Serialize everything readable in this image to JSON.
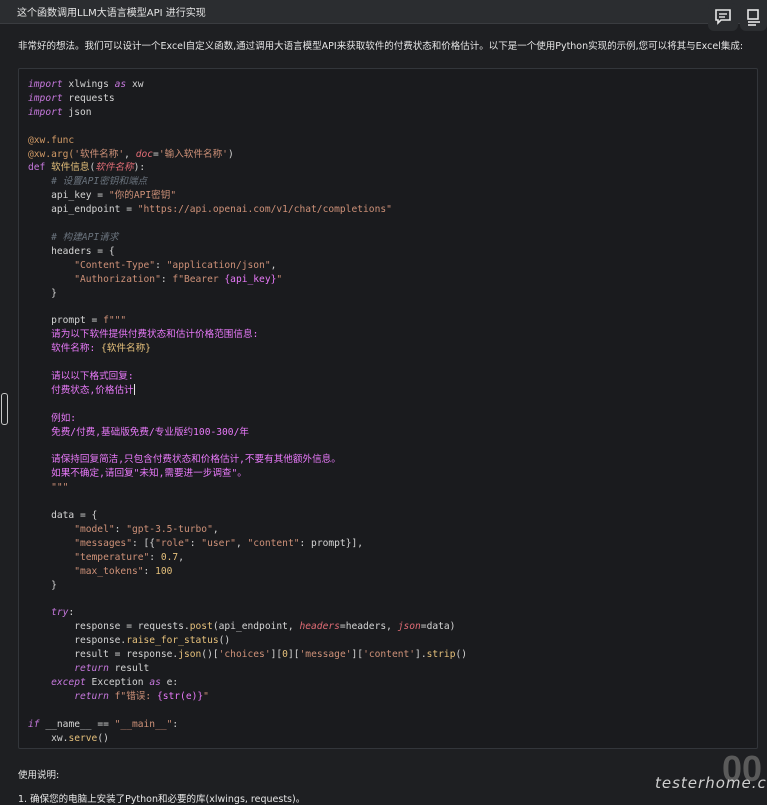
{
  "question": "这个函数调用LLM大语言模型API 进行实现",
  "intro": "非常好的想法。我们可以设计一个Excel自定义函数,通过调用大语言模型API来获取软件的付费状态和价格估计。以下是一个使用Python实现的示例,您可以将其与Excel集成:",
  "code": {
    "l1_import": "import",
    "l1_mod": " xlwings ",
    "l1_as": "as",
    "l1_alias": " xw",
    "l2_import": "import",
    "l2_mod": " requests",
    "l3_import": "import",
    "l3_mod": " json",
    "l5_dec": "@xw.func",
    "l6_dec": "@xw.arg(",
    "l6_str": "'软件名称'",
    "l6_mid": ", ",
    "l6_kw": "doc",
    "l6_eq": "=",
    "l6_str2": "'输入软件名称'",
    "l6_end": ")",
    "l7_def": "def",
    "l7_sp": " ",
    "l7_fn": "软件信息",
    "l7_p1": "(",
    "l7_param": "软件名称",
    "l7_p2": "):",
    "l8_cmt": "    # 设置API密钥和端点",
    "l9_var": "    api_key = ",
    "l9_str": "\"你的API密钥\"",
    "l10_var": "    api_endpoint = ",
    "l10_str": "\"https://api.openai.com/v1/chat/completions\"",
    "l12_cmt": "    # 构建API请求",
    "l13": "    headers = {",
    "l14_k": "        \"Content-Type\"",
    "l14_c": ": ",
    "l14_v": "\"application/json\"",
    "l14_e": ",",
    "l15_k": "        \"Authorization\"",
    "l15_c": ": ",
    "l15_v": "f\"Bearer ",
    "l15_b": "{api_key}",
    "l15_q": "\"",
    "l16": "    }",
    "l18_var": "    prompt = ",
    "l18_str": "f\"\"\"",
    "l19": "    请为以下软件提供付费状态和估计价格范围信息:",
    "l20_a": "    软件名称: ",
    "l20_b": "{软件名称}",
    "l22": "    请以以下格式回复:",
    "l23": "    付费状态,价格估计",
    "l25": "    例如:",
    "l26": "    免费/付费,基础版免费/专业版约100-300/年",
    "l28": "    请保持回复简洁,只包含付费状态和价格估计,不要有其他额外信息。",
    "l29": "    如果不确定,请回复\"未知,需要进一步调查\"。",
    "l30": "    \"\"\"",
    "l32": "    data = {",
    "l33_k": "        \"model\"",
    "l33_c": ": ",
    "l33_v": "\"gpt-3.5-turbo\"",
    "l33_e": ",",
    "l34_k": "        \"messages\"",
    "l34_c": ": [{",
    "l34_k2": "\"role\"",
    "l34_c2": ": ",
    "l34_v2": "\"user\"",
    "l34_c3": ", ",
    "l34_k3": "\"content\"",
    "l34_c4": ": prompt}],",
    "l35_k": "        \"temperature\"",
    "l35_c": ": ",
    "l35_v": "0.7",
    "l35_e": ",",
    "l36_k": "        \"max_tokens\"",
    "l36_c": ": ",
    "l36_v": "100",
    "l37": "    }",
    "l39_try": "    try",
    "l39_e": ":",
    "l40_a": "        response = requests.",
    "l40_f": "post",
    "l40_b": "(api_endpoint, ",
    "l40_k1": "headers",
    "l40_c": "=headers, ",
    "l40_k2": "json",
    "l40_d": "=data)",
    "l41_a": "        response.",
    "l41_f": "raise_for_status",
    "l41_b": "()",
    "l42_a": "        result = response.",
    "l42_f": "json",
    "l42_b": "()[",
    "l42_s1": "'choices'",
    "l42_c": "][",
    "l42_n": "0",
    "l42_d": "][",
    "l42_s2": "'message'",
    "l42_e": "][",
    "l42_s3": "'content'",
    "l42_g": "].",
    "l42_f2": "strip",
    "l42_h": "()",
    "l43_kw": "        return",
    "l43_v": " result",
    "l44_kw": "    except",
    "l44_a": " Exception ",
    "l44_as": "as",
    "l44_b": " e:",
    "l45_kw": "        return",
    "l45_s": " f\"错误: ",
    "l45_b": "{str(e)}",
    "l45_q": "\"",
    "l47_if": "if",
    "l47_a": " __name__ == ",
    "l47_s": "\"__main__\"",
    "l47_b": ":",
    "l48_a": "    xw.",
    "l48_f": "serve",
    "l48_b": "()"
  },
  "usage": {
    "title": "使用说明:",
    "step1": "1. 确保您的电脑上安装了Python和必要的库(xlwings, requests)。"
  },
  "watermark": {
    "site": "testerhome.com",
    "big": "00"
  },
  "icons": {
    "comment": "comment-icon",
    "outline": "outline-icon"
  }
}
